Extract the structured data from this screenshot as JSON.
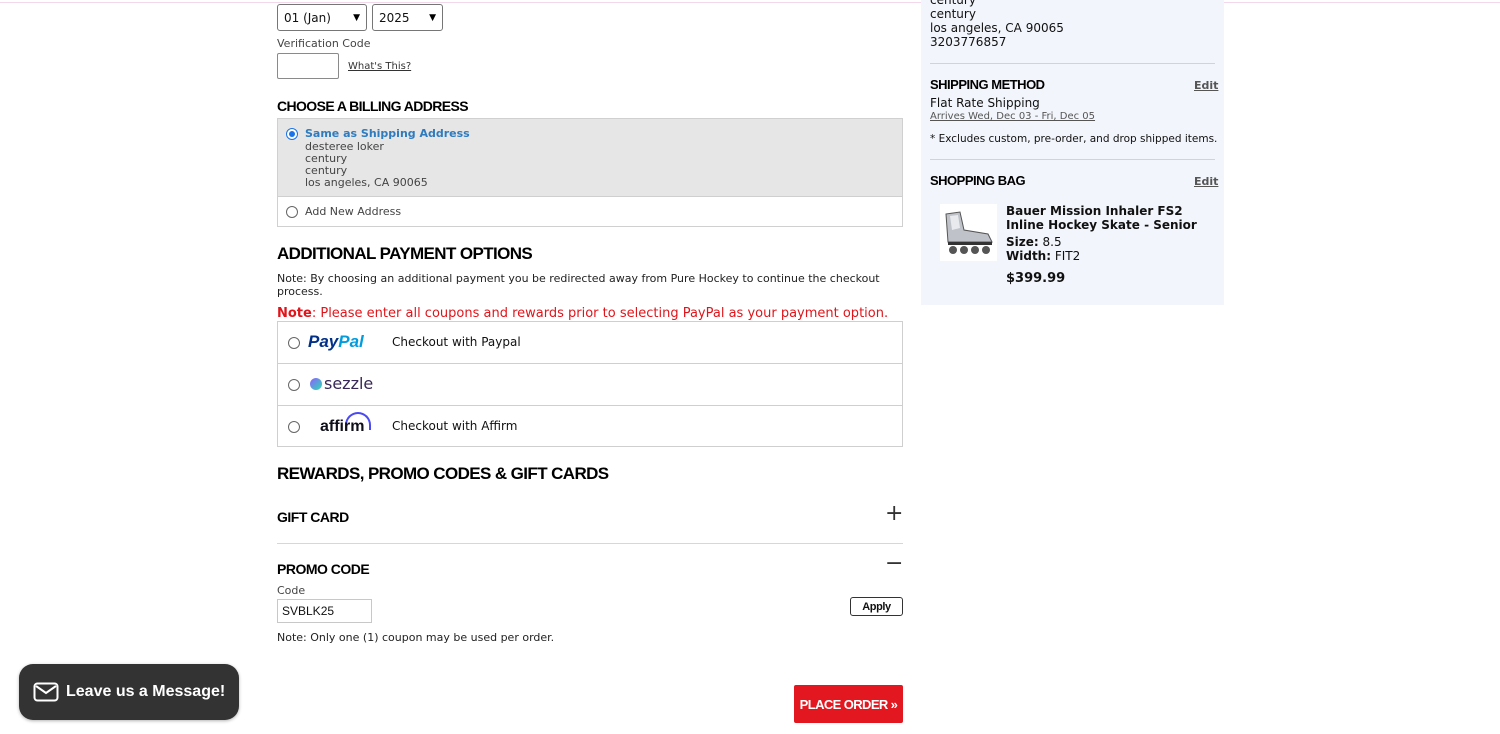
{
  "payment": {
    "month": "01 (Jan)",
    "year": "2025",
    "verification_label": "Verification Code",
    "verification_value": "",
    "whats_this": "What's This?"
  },
  "billing": {
    "title": "CHOOSE A BILLING ADDRESS",
    "same_label": "Same as Shipping Address",
    "address": [
      "desteree loker",
      "century",
      "century",
      "los angeles, CA 90065"
    ],
    "add_new": "Add New Address"
  },
  "additional": {
    "title": "ADDITIONAL PAYMENT OPTIONS",
    "note": "Note: By choosing an additional payment you be redirected away from Pure Hockey to continue the checkout process.",
    "red_note_prefix": "Note",
    "red_note": ": Please enter all coupons and rewards prior to selecting PayPal as your payment option.",
    "options": [
      {
        "logo_a": "Pay",
        "logo_b": "Pal",
        "label": "Checkout with Paypal"
      },
      {
        "logo": "sezzle",
        "label": ""
      },
      {
        "logo": "affirm",
        "label": "Checkout with Affirm"
      }
    ]
  },
  "rewards": {
    "title": "REWARDS, PROMO CODES & GIFT CARDS",
    "gift_card": "GIFT CARD",
    "promo_code": "PROMO CODE",
    "code_label": "Code",
    "code_value": "SVBLK25",
    "apply": "Apply",
    "note": "Note: Only one (1) coupon may be used per order."
  },
  "place_order": "PLACE ORDER »",
  "summary": {
    "address_cut": "century",
    "address": [
      "century",
      "los angeles, CA 90065",
      "3203776857"
    ],
    "shipping_title": "SHIPPING METHOD",
    "edit": "Edit",
    "shipping_name": "Flat Rate Shipping",
    "arrives": "Arrives Wed, Dec 03 - Fri, Dec 05",
    "excludes": "* Excludes custom, pre-order, and drop shipped items.",
    "bag_title": "SHOPPING BAG",
    "product": {
      "name": "Bauer Mission Inhaler FS2 Inline Hockey Skate - Senior",
      "size_label": "Size:",
      "size": "8.5",
      "width_label": "Width:",
      "width": "FIT2",
      "price": "$399.99"
    }
  },
  "chat": {
    "label": "Leave us a Message!"
  },
  "colors": {
    "accent_red": "#e3171f",
    "link_blue": "#2e7bbf",
    "summary_bg": "#f2f5fb"
  },
  "icons": [
    "chevron-down-icon",
    "plus-icon",
    "minus-icon",
    "envelope-icon"
  ]
}
